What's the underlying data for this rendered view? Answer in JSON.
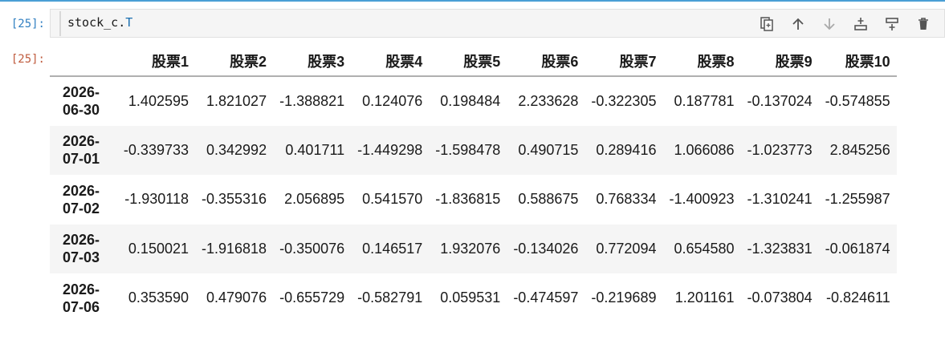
{
  "prompts": {
    "input": "[25]:",
    "output": "[25]:"
  },
  "code": {
    "object": "stock_c",
    "dot": ".",
    "attribute": "T"
  },
  "toolbar": [
    {
      "name": "duplicate-icon",
      "label": "duplicate"
    },
    {
      "name": "arrow-up-icon",
      "label": "move up"
    },
    {
      "name": "arrow-down-icon",
      "label": "move down"
    },
    {
      "name": "insert-above-icon",
      "label": "insert above"
    },
    {
      "name": "insert-below-icon",
      "label": "insert below"
    },
    {
      "name": "trash-icon",
      "label": "delete"
    }
  ],
  "table": {
    "index_header": "",
    "columns": [
      "股票1",
      "股票2",
      "股票3",
      "股票4",
      "股票5",
      "股票6",
      "股票7",
      "股票8",
      "股票9",
      "股票10"
    ],
    "rows": [
      {
        "index_top": "2026-",
        "index_bottom": "06-30",
        "values": [
          "1.402595",
          "1.821027",
          "-1.388821",
          "0.124076",
          "0.198484",
          "2.233628",
          "-0.322305",
          "0.187781",
          "-0.137024",
          "-0.574855"
        ]
      },
      {
        "index_top": "2026-",
        "index_bottom": "07-01",
        "values": [
          "-0.339733",
          "0.342992",
          "0.401711",
          "-1.449298",
          "-1.598478",
          "0.490715",
          "0.289416",
          "1.066086",
          "-1.023773",
          "2.845256"
        ]
      },
      {
        "index_top": "2026-",
        "index_bottom": "07-02",
        "values": [
          "-1.930118",
          "-0.355316",
          "2.056895",
          "0.541570",
          "-1.836815",
          "0.588675",
          "0.768334",
          "-1.400923",
          "-1.310241",
          "-1.255987"
        ]
      },
      {
        "index_top": "2026-",
        "index_bottom": "07-03",
        "values": [
          "0.150021",
          "-1.916818",
          "-0.350076",
          "0.146517",
          "1.932076",
          "-0.134026",
          "0.772094",
          "0.654580",
          "-1.323831",
          "-0.061874"
        ]
      },
      {
        "index_top": "2026-",
        "index_bottom": "07-06",
        "values": [
          "0.353590",
          "0.479076",
          "-0.655729",
          "-0.582791",
          "0.059531",
          "-0.474597",
          "-0.219689",
          "1.201161",
          "-0.073804",
          "-0.824611"
        ]
      }
    ]
  },
  "colors": {
    "top_rule": "#4a9fd5",
    "input_prompt": "#307fc1",
    "output_prompt": "#bf5b3d",
    "stripe": "#f5f5f5"
  }
}
